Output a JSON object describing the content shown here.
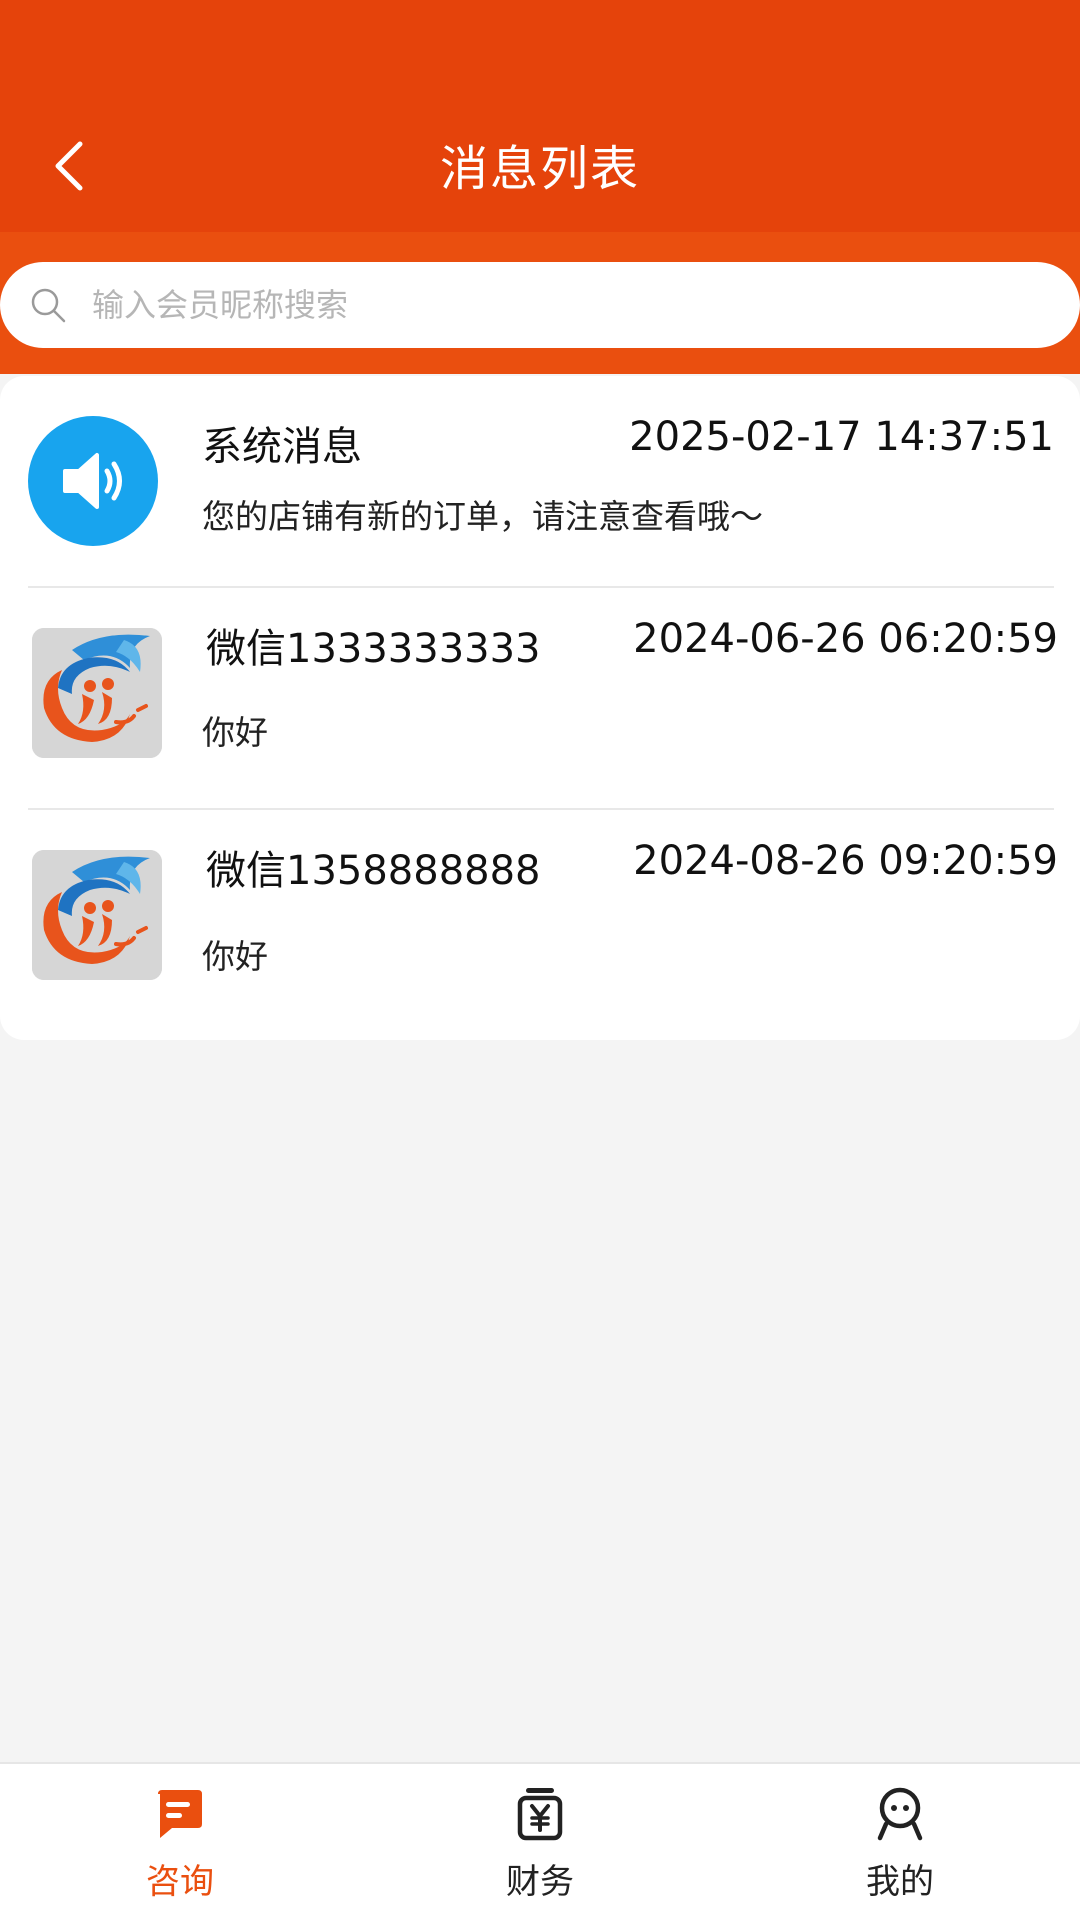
{
  "header": {
    "title": "消息列表",
    "back_icon": "chevron-left-icon",
    "background_color": "#e5430b"
  },
  "search": {
    "placeholder": "输入会员昵称搜索",
    "value": "",
    "icon": "search-icon"
  },
  "messages": [
    {
      "avatar": "speaker-icon",
      "name": "系统消息",
      "time": "2025-02-17 14:37:51",
      "preview": "您的店铺有新的订单，请注意查看哦～"
    },
    {
      "avatar": "brand-logo",
      "name": "微信1333333333",
      "time": "2024-06-26 06:20:59",
      "preview": "你好"
    },
    {
      "avatar": "brand-logo",
      "name": "微信1358888888",
      "time": "2024-08-26 09:20:59",
      "preview": "你好"
    }
  ],
  "tabbar": {
    "items": [
      {
        "label": "咨询",
        "icon": "chat-icon",
        "active": true
      },
      {
        "label": "财务",
        "icon": "finance-icon",
        "active": false
      },
      {
        "label": "我的",
        "icon": "profile-icon",
        "active": false
      }
    ],
    "active_color": "#ea4f0f"
  }
}
